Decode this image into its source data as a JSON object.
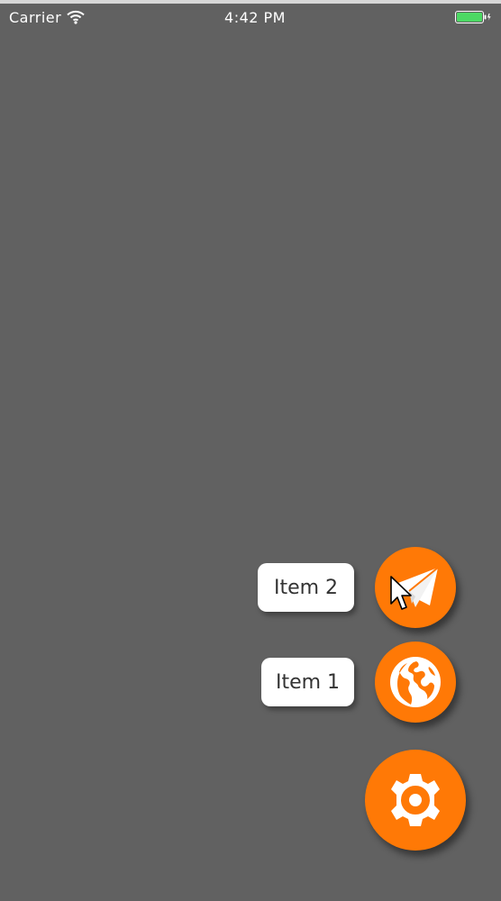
{
  "status_bar": {
    "carrier": "Carrier",
    "time": "4:42 PM",
    "icons": [
      "wifi-icon",
      "battery-icon",
      "charging-bolt-icon"
    ],
    "battery_color": "#4cd964"
  },
  "background_color": "#616161",
  "fab_menu": {
    "accent_color": "#ff7906",
    "items": [
      {
        "label": "Item 2",
        "icon": "paper-plane-icon"
      },
      {
        "label": "Item 1",
        "icon": "globe-icon"
      }
    ],
    "main_button": {
      "icon": "gear-icon"
    }
  }
}
